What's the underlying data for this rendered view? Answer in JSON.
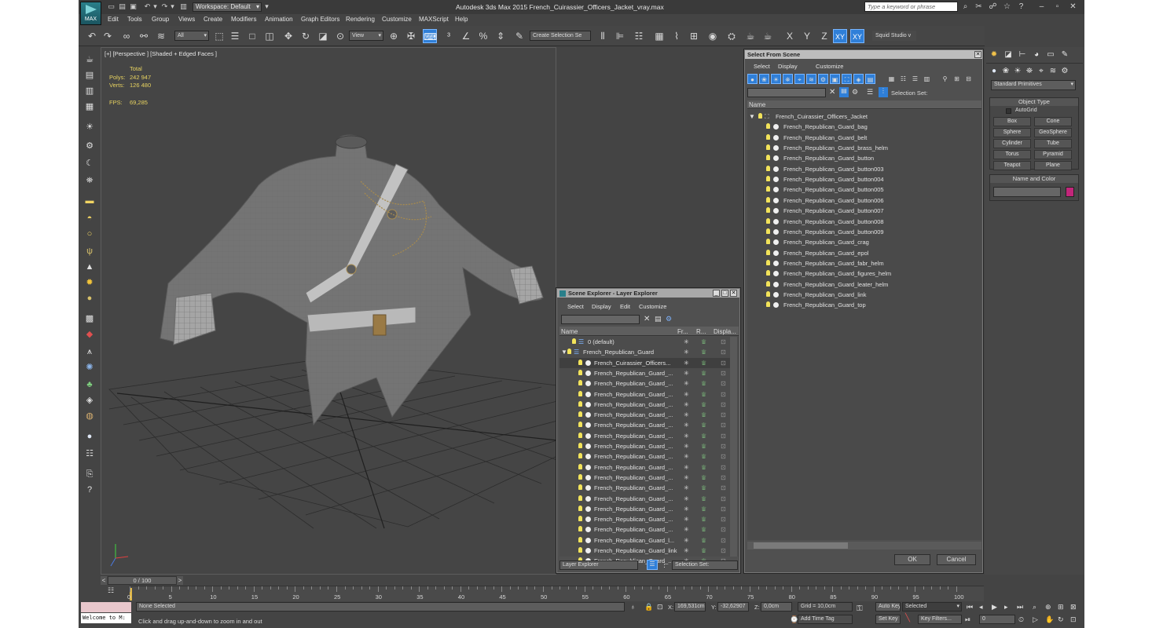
{
  "app": {
    "logo_text": "MAX",
    "workspace": "Workspace: Default",
    "title": "Autodesk 3ds Max  2015     French_Cuirassier_Officers_Jacket_vray.max",
    "search_placeholder": "Type a keyword or phrase"
  },
  "menu": [
    "Edit",
    "Tools",
    "Group",
    "Views",
    "Create",
    "Modifiers",
    "Animation",
    "Graph Editors",
    "Rendering",
    "Customize",
    "MAXScript",
    "Help"
  ],
  "toolbar": {
    "filter": "All",
    "coord": "View",
    "selection_set": "Create Selection Se",
    "axis": [
      "X",
      "Y",
      "Z",
      "XY",
      "XY"
    ],
    "studio": "Squid Studio v"
  },
  "viewport": {
    "label": "[+] [Perspective ] [Shaded + Edged Faces ]",
    "stats_header": "Total",
    "stats": [
      {
        "label": "Polys:",
        "value": "242 947"
      },
      {
        "label": "Verts:",
        "value": "126 480"
      },
      {
        "label": "FPS:",
        "value": "69,285"
      }
    ]
  },
  "scene_explorer": {
    "title": "Scene Explorer - Layer Explorer",
    "menu": [
      "Select",
      "Display",
      "Edit",
      "Customize"
    ],
    "columns": [
      "Name",
      "Fr...",
      "R...",
      "Displa..."
    ],
    "rows": [
      "0 (default)",
      "French_Republican_Guard",
      "French_Cuirassier_Officers...",
      "French_Republican_Guard_...",
      "French_Republican_Guard_...",
      "French_Republican_Guard_...",
      "French_Republican_Guard_...",
      "French_Republican_Guard_...",
      "French_Republican_Guard_...",
      "French_Republican_Guard_...",
      "French_Republican_Guard_...",
      "French_Republican_Guard_...",
      "French_Republican_Guard_...",
      "French_Republican_Guard_...",
      "French_Republican_Guard_...",
      "French_Republican_Guard_...",
      "French_Republican_Guard_...",
      "French_Republican_Guard_...",
      "French_Republican_Guard_...",
      "French_Republican_Guard_l...",
      "French_Republican_Guard_link",
      "French_Republican_Guard_..."
    ],
    "footer_left": "Layer Explorer",
    "footer_right": "Selection Set:"
  },
  "select_from_scene": {
    "title": "Select From Scene",
    "menu": [
      "Select",
      "Display",
      "Customize"
    ],
    "selection_set_label": "Selection Set:",
    "column": "Name",
    "root": "French_Cuirassier_Officers_Jacket",
    "items": [
      "French_Republican_Guard_bag",
      "French_Republican_Guard_belt",
      "French_Republican_Guard_brass_helm",
      "French_Republican_Guard_button",
      "French_Republican_Guard_button003",
      "French_Republican_Guard_button004",
      "French_Republican_Guard_button005",
      "French_Republican_Guard_button006",
      "French_Republican_Guard_button007",
      "French_Republican_Guard_button008",
      "French_Republican_Guard_button009",
      "French_Republican_Guard_crag",
      "French_Republican_Guard_epol",
      "French_Republican_Guard_fabr_helm",
      "French_Republican_Guard_figures_helm",
      "French_Republican_Guard_leater_helm",
      "French_Republican_Guard_link",
      "French_Republican_Guard_top"
    ],
    "ok": "OK",
    "cancel": "Cancel"
  },
  "command_panel": {
    "category": "Standard Primitives",
    "object_type": "Object Type",
    "autogrid": "AutoGrid",
    "buttons": [
      "Box",
      "Cone",
      "Sphere",
      "GeoSphere",
      "Cylinder",
      "Tube",
      "Torus",
      "Pyramid",
      "Teapot",
      "Plane"
    ],
    "name_color": "Name and Color",
    "color": "#c2267a"
  },
  "timeline": {
    "frame": "0 / 100",
    "ticks": [
      "0",
      "5",
      "10",
      "15",
      "20",
      "25",
      "30",
      "35",
      "40",
      "45",
      "50",
      "55",
      "60",
      "65",
      "70",
      "75",
      "80",
      "85",
      "90",
      "95",
      "100"
    ]
  },
  "status": {
    "script_text": "Welcome to M:",
    "selection": "None Selected",
    "prompt": "Click and drag up-and-down to zoom in and out",
    "x": "169,531cm",
    "y": "-32,62907",
    "z": "0,0cm",
    "grid": "Grid = 10,0cm",
    "add_time_tag": "Add Time Tag",
    "auto_key": "Auto Key",
    "selected": "Selected",
    "set_key": "Set Key",
    "key_filters": "Key Filters...",
    "frame_field": "0"
  }
}
